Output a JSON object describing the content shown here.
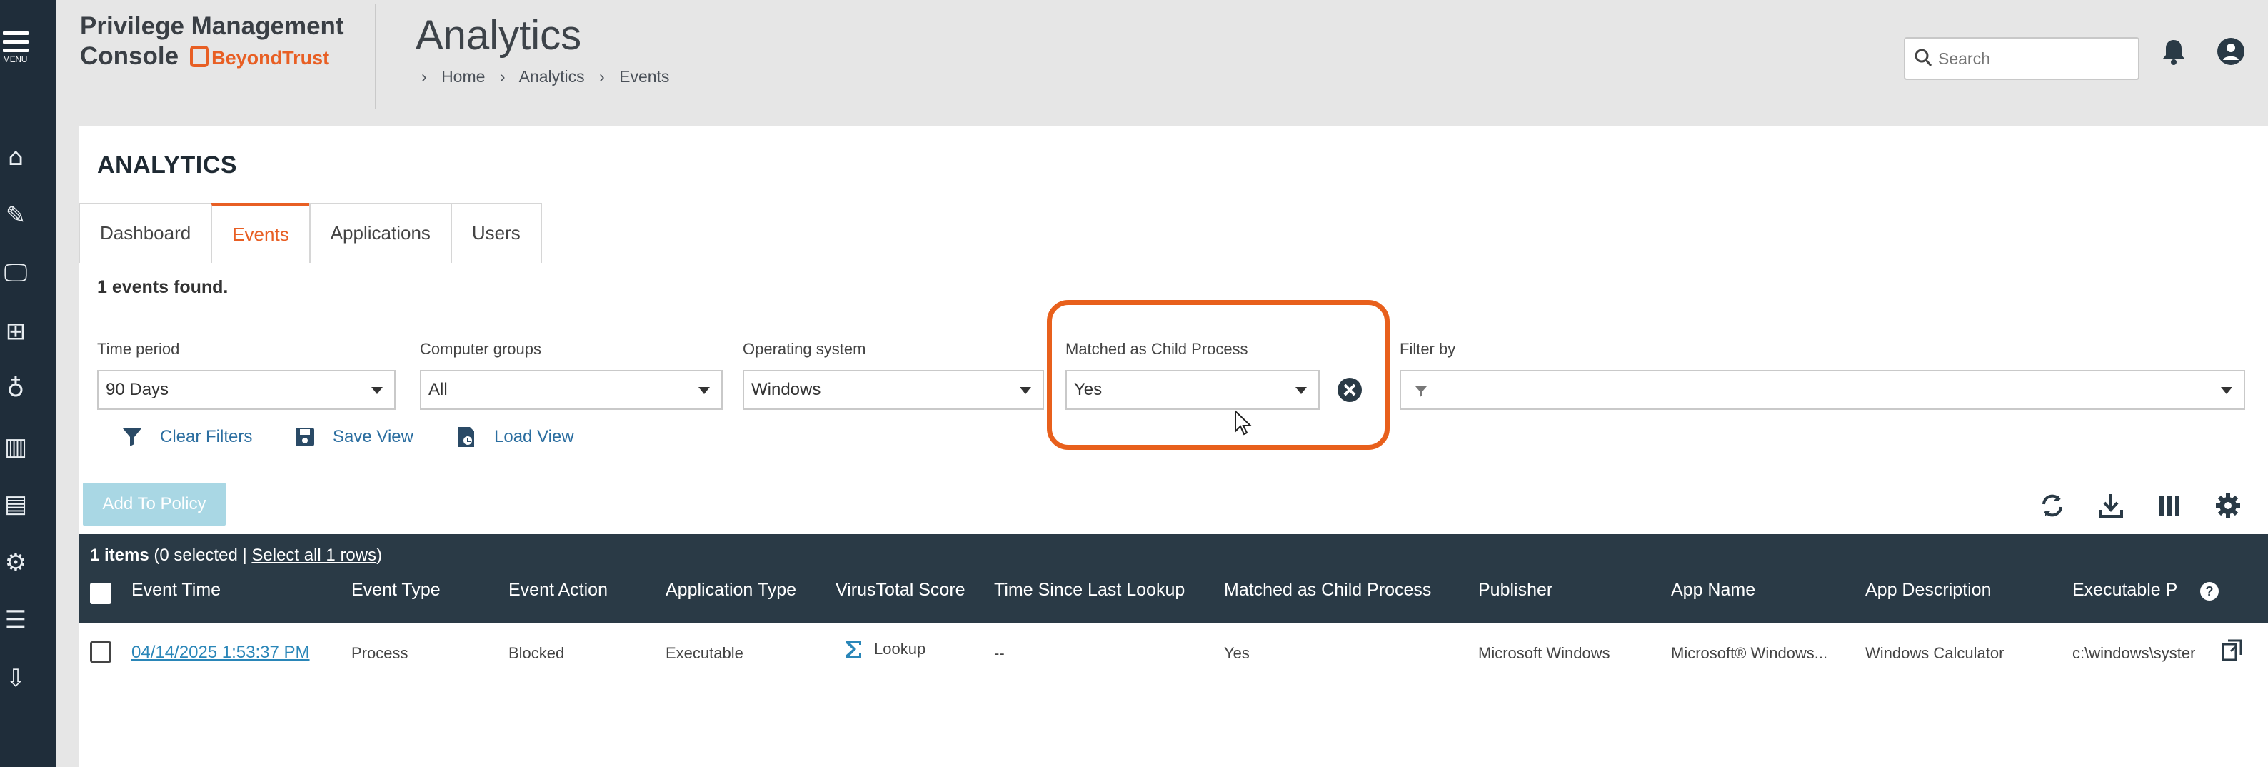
{
  "nav": {
    "menu_label": "MENU",
    "icons": [
      "home-icon",
      "policies-icon",
      "computers-icon",
      "groups-icon",
      "insights-icon",
      "analytics-icon",
      "inbox-icon",
      "settings-icon",
      "reports-icon",
      "downloads-icon"
    ]
  },
  "header": {
    "brand_line1": "Privilege Management",
    "brand_line2": "Console",
    "brand_partner": "BeyondTrust",
    "page_title": "Analytics",
    "breadcrumb": [
      "Home",
      "Analytics",
      "Events"
    ],
    "search_placeholder": "Search"
  },
  "panel": {
    "title": "ANALYTICS",
    "tabs": [
      "Dashboard",
      "Events",
      "Applications",
      "Users"
    ],
    "active_tab": "Events",
    "found": "1 events found."
  },
  "filters": {
    "time_period": {
      "label": "Time period",
      "value": "90 Days"
    },
    "computer_groups": {
      "label": "Computer groups",
      "value": "All"
    },
    "operating_system": {
      "label": "Operating system",
      "value": "Windows"
    },
    "child_process": {
      "label": "Matched as Child Process",
      "value": "Yes"
    },
    "filter_by": {
      "label": "Filter by",
      "value": ""
    }
  },
  "actions": {
    "clear_filters": "Clear Filters",
    "save_view": "Save View",
    "load_view": "Load View",
    "add_to_policy": "Add To Policy"
  },
  "grid": {
    "items_count": "1 items",
    "selected_text": "(0 selected |",
    "select_all": "Select all 1 rows",
    "select_close": ")",
    "columns": [
      "Event Time",
      "Event Type",
      "Event Action",
      "Application Type",
      "VirusTotal Score",
      "Time Since Last Lookup",
      "Matched as Child Process",
      "Publisher",
      "App Name",
      "App Description",
      "Executable P"
    ],
    "rows": [
      {
        "event_time": "04/14/2025 1:53:37 PM",
        "event_type": "Process",
        "event_action": "Blocked",
        "application_type": "Executable",
        "virustotal_score": "Lookup",
        "time_since_lookup": "--",
        "matched_child": "Yes",
        "publisher": "Microsoft Windows",
        "app_name": "Microsoft® Windows...",
        "app_description": "Windows Calculator",
        "executable_path": "c:\\windows\\syster"
      }
    ]
  },
  "colors": {
    "accent": "#e85f24",
    "rail": "#1f2d3a",
    "grid_header": "#2a3a46",
    "link": "#2a86b8"
  }
}
